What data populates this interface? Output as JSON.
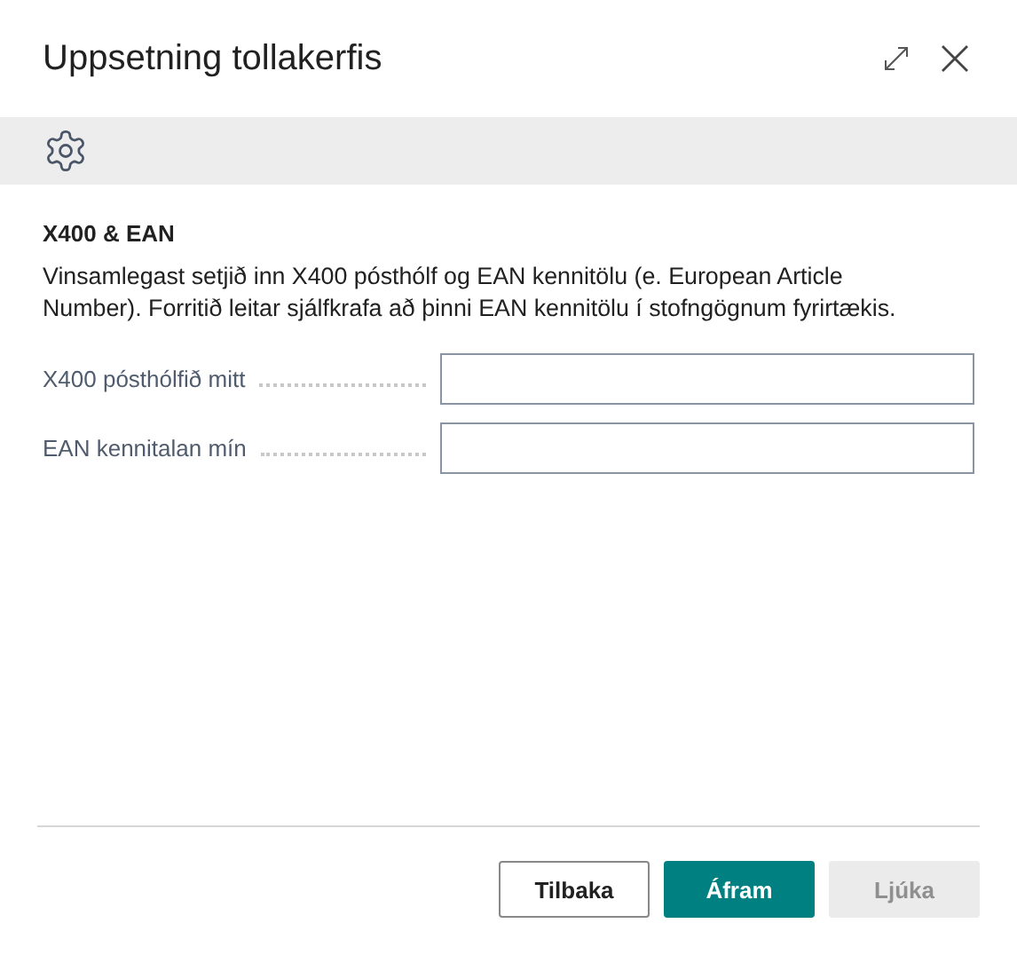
{
  "window": {
    "title": "Uppsetning tollakerfis"
  },
  "section": {
    "title": "X400 & EAN",
    "description": "Vinsamlegast setjið inn X400 pósthólf og EAN kennitölu (e. European Article Number). Forritið leitar sjálfkrafa að þinni EAN kennitölu í stofngögnum fyrirtækis."
  },
  "fields": [
    {
      "label": "X400 pósthólfið mitt"
    },
    {
      "label": "EAN kennitalan mín"
    }
  ],
  "buttons": [
    {
      "label": "Tilbaka",
      "kind": "secondary",
      "disabled": false
    },
    {
      "label": "Áfram",
      "kind": "primary",
      "disabled": false
    },
    {
      "label": "Ljúka",
      "kind": "primary",
      "disabled": true
    }
  ]
}
